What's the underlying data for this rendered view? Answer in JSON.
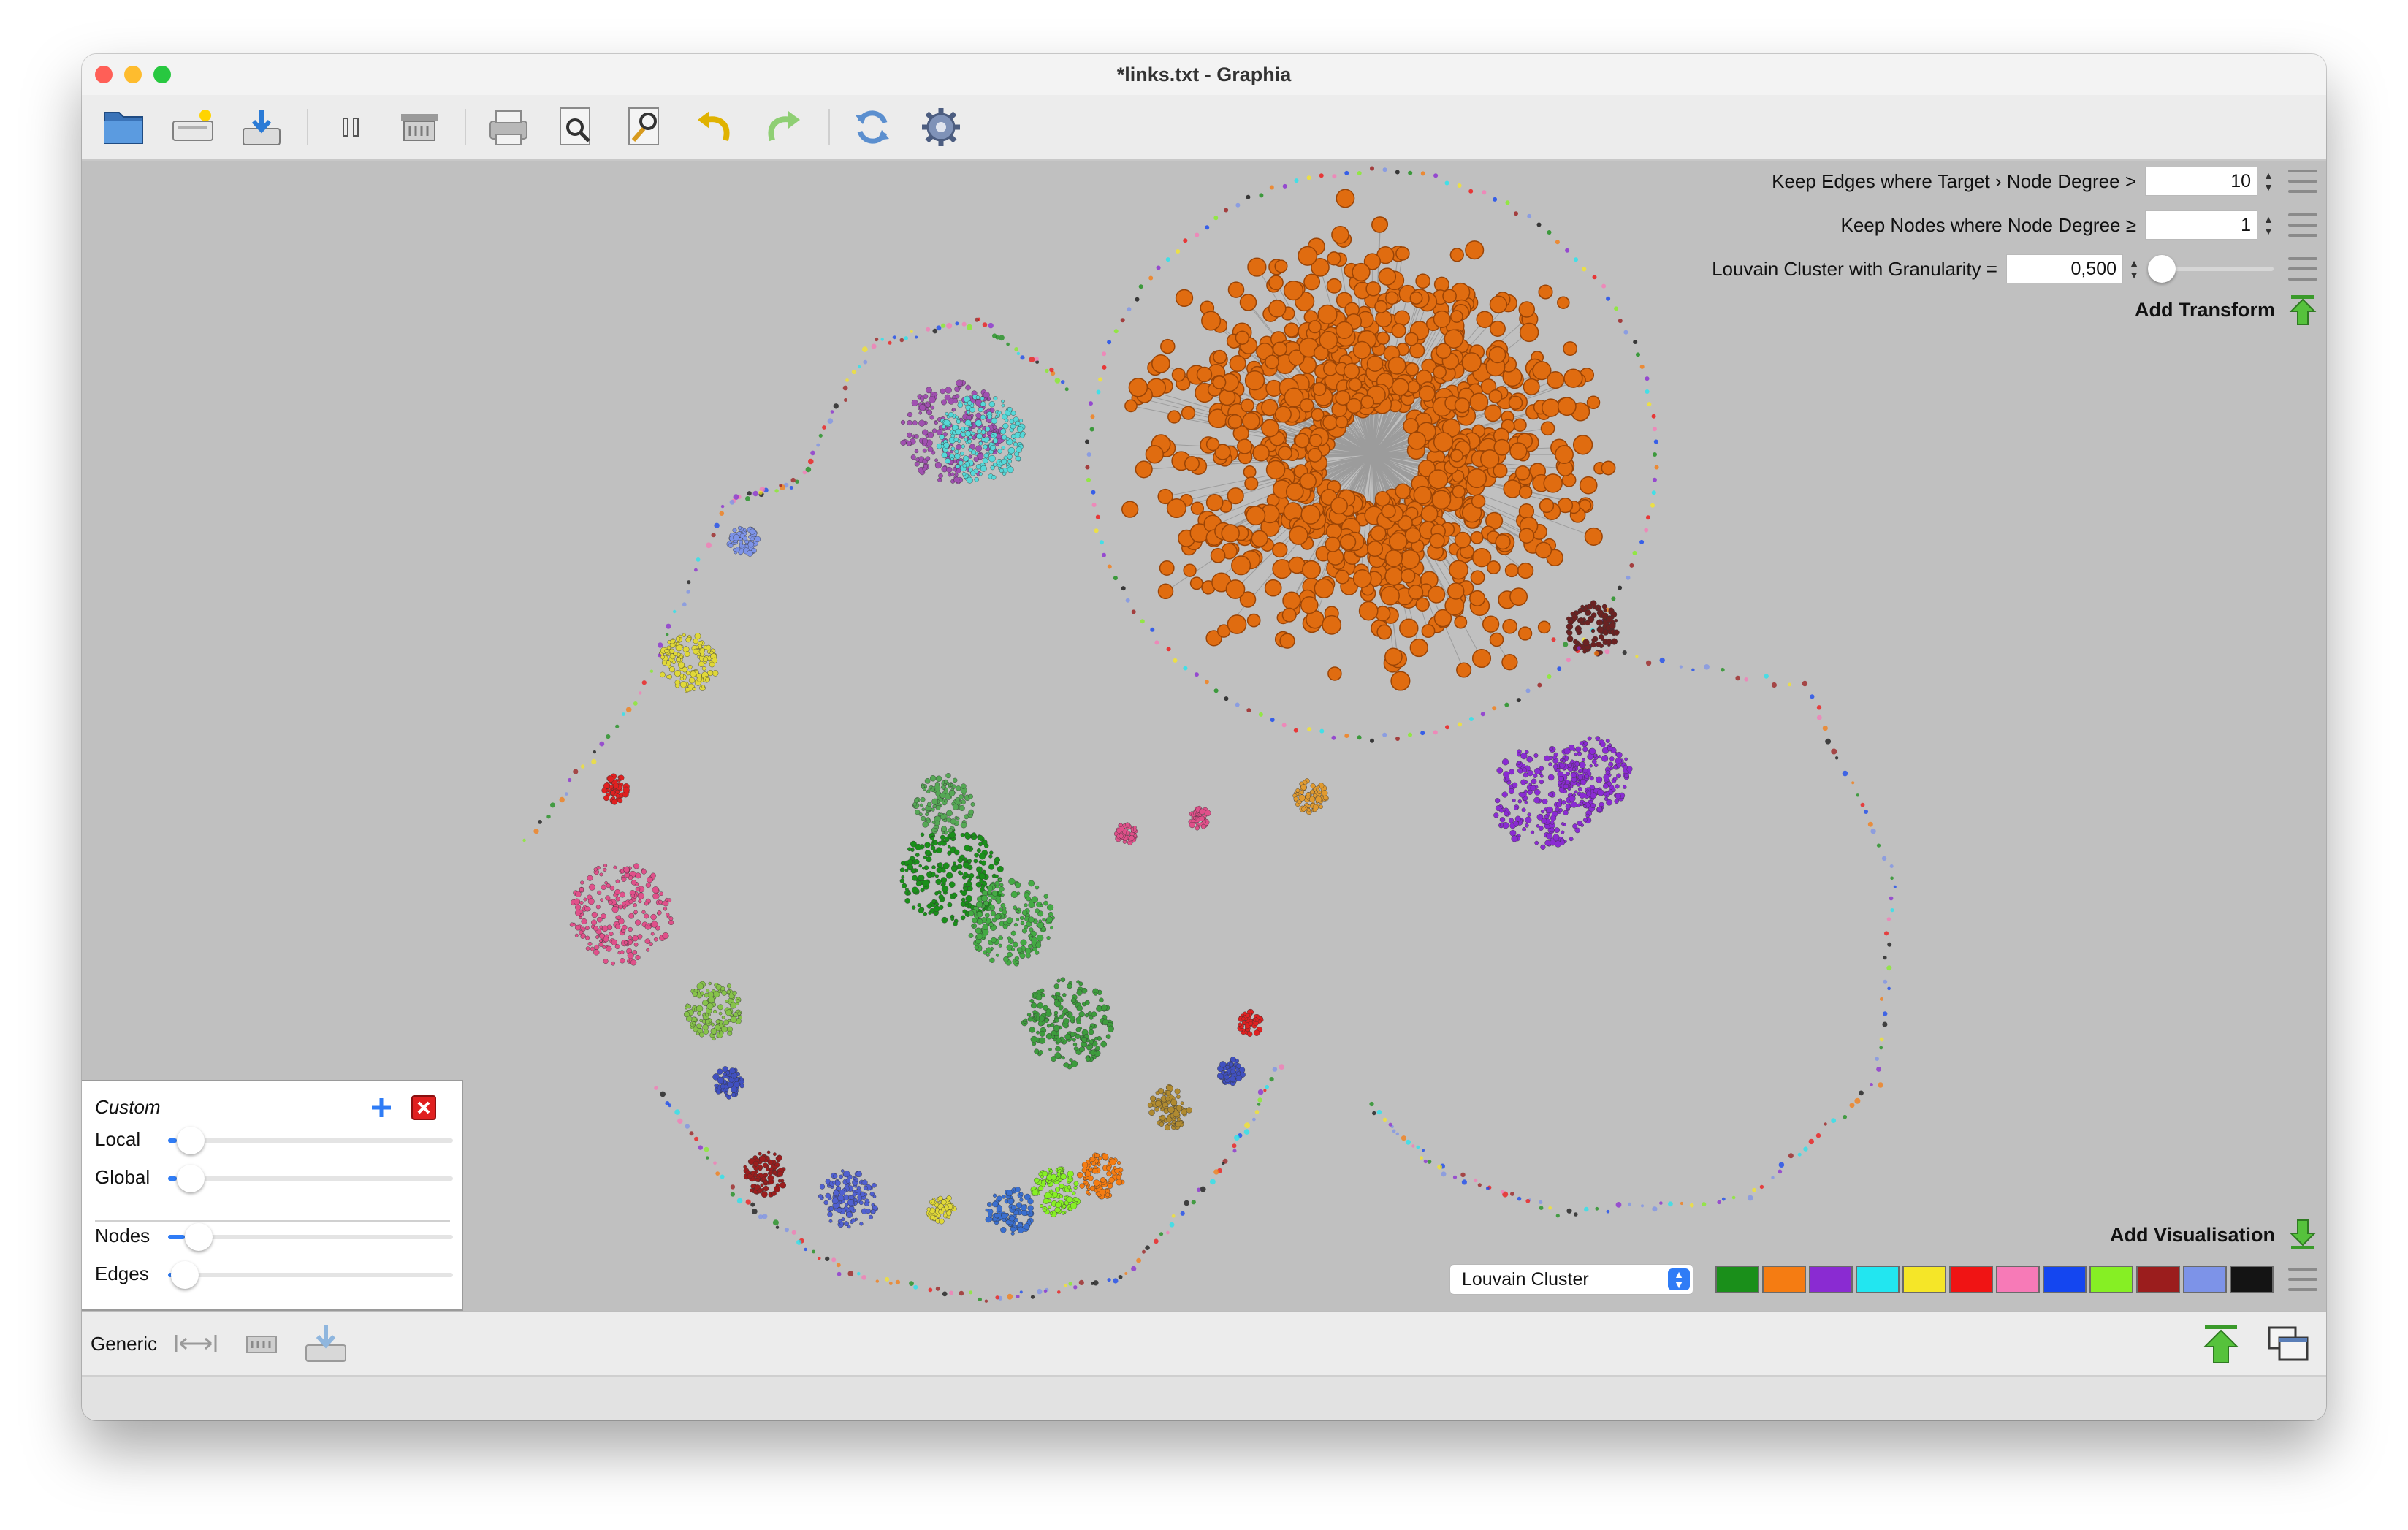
{
  "window": {
    "title": "*links.txt - Graphia"
  },
  "toolbar": {
    "buttons": [
      "open-file",
      "new-tab",
      "save",
      "pause",
      "delete",
      "print",
      "find",
      "find-by-attribute",
      "undo",
      "redo",
      "refresh",
      "settings"
    ]
  },
  "transforms": [
    {
      "label": "Keep Edges where Target › Node Degree >",
      "value": "10"
    },
    {
      "label": "Keep Nodes where Node Degree ≥",
      "value": "1"
    },
    {
      "label": "Louvain Cluster with Granularity =",
      "value": "0,500",
      "slider": 0.05
    }
  ],
  "add_transform_label": "Add Transform",
  "add_visualisation_label": "Add Visualisation",
  "visualisation": {
    "attribute": "Louvain Cluster",
    "palette": [
      "#1a8f1a",
      "#f57c12",
      "#8a2bd2",
      "#22e6f0",
      "#f5e628",
      "#f01414",
      "#f77ab7",
      "#1446f0",
      "#86ef24",
      "#9b1d1d",
      "#7d93e8",
      "#141414"
    ]
  },
  "layout_panel": {
    "title": "Custom",
    "sliders": [
      {
        "label": "Local",
        "value": 0.03
      },
      {
        "label": "Global",
        "value": 0.03
      },
      {
        "label": "Nodes",
        "value": 0.06
      },
      {
        "label": "Edges",
        "value": 0.01
      }
    ]
  },
  "bottom_bar": {
    "label": "Generic"
  },
  "colors": {
    "canvas": "#c0c0c0",
    "hub": "#e06c10",
    "accent": "#2f7cf6"
  }
}
